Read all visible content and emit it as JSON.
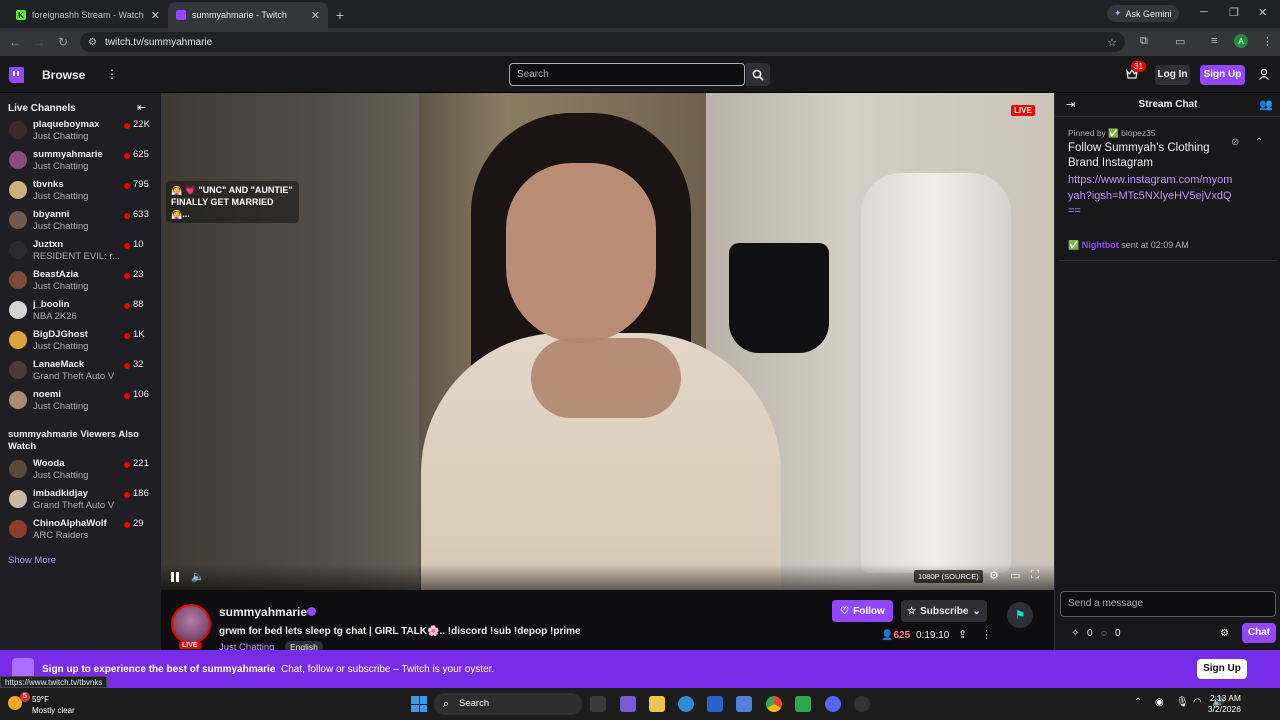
{
  "browser": {
    "tabs": [
      {
        "title": "foreignashh Stream - Watch Live",
        "favicon_color": "#53fc18",
        "favicon_letter": "K"
      },
      {
        "title": "summyahmarie - Twitch",
        "favicon_color": "#9147ff",
        "favicon_letter": ""
      }
    ],
    "gemini_label": "Ask Gemini",
    "url": "twitch.tv/summyahmarie",
    "profile_initial": "A"
  },
  "twitch_nav": {
    "browse": "Browse",
    "search_placeholder": "Search",
    "notifications_count": "31",
    "login": "Log In",
    "signup": "Sign Up"
  },
  "sidebar": {
    "live_header": "Live Channels",
    "channels": [
      {
        "name": "plaqueboymax",
        "game": "Just Chatting",
        "viewers": "22K",
        "avatar_color": "#3b2a2a"
      },
      {
        "name": "summyahmarie",
        "game": "Just Chatting",
        "viewers": "625",
        "avatar_color": "#8a4c78"
      },
      {
        "name": "tbvnks",
        "game": "Just Chatting",
        "viewers": "795",
        "avatar_color": "#c9b27e"
      },
      {
        "name": "bbyanni",
        "game": "Just Chatting",
        "viewers": "633",
        "avatar_color": "#6e5a4f"
      },
      {
        "name": "Juztxn",
        "game": "RESIDENT EVIL: r...",
        "viewers": "10",
        "avatar_color": "#2a2a2e"
      },
      {
        "name": "BeastAzia",
        "game": "Just Chatting",
        "viewers": "23",
        "avatar_color": "#7a4a3a"
      },
      {
        "name": "j_boolin",
        "game": "NBA 2K26",
        "viewers": "88",
        "avatar_color": "#d5d5d5"
      },
      {
        "name": "BigDJGhost",
        "game": "Just Chatting",
        "viewers": "1K",
        "avatar_color": "#d9a441"
      },
      {
        "name": "LanaeMack",
        "game": "Grand Theft Auto V",
        "viewers": "32",
        "avatar_color": "#4a3b36"
      },
      {
        "name": "noemi",
        "game": "Just Chatting",
        "viewers": "106",
        "avatar_color": "#a58d78"
      }
    ],
    "also_watch_header": "summyahmarie Viewers Also Watch",
    "also_watch": [
      {
        "name": "Wooda",
        "game": "Just Chatting",
        "viewers": "221",
        "avatar_color": "#5a4a3a"
      },
      {
        "name": "imbadkidjay",
        "game": "Grand Theft Auto V",
        "viewers": "186",
        "avatar_color": "#c7b9a5"
      },
      {
        "name": "ChinoAlphaWolf",
        "game": "ARC Raiders",
        "viewers": "29",
        "avatar_color": "#8c3b2f"
      }
    ],
    "show_more": "Show More"
  },
  "player": {
    "overlay_text": "👰 💗 \"UNC\" AND \"AUNTIE\" FINALLY GET MARRIED 👰...",
    "live_badge": "LIVE",
    "quality": "1080P (SOURCE)"
  },
  "stream_info": {
    "live_badge": "LIVE",
    "streamer": "summyahmarie",
    "title": "grwm for bed lets sleep tg chat | GIRL TALK🌸.. !discord !sub !depop !prime",
    "category": "Just Chatting",
    "tag": "English",
    "follow": "Follow",
    "subscribe": "Subscribe",
    "viewers": "625",
    "uptime": "0:19:10"
  },
  "chat": {
    "header": "Stream Chat",
    "pinned_by": "Pinned by ✅ blopez35",
    "pinned_message": "Follow Summyah's Clothing Brand Instagram",
    "pinned_link": "https://www.instagram.com/myomyah?igsh=MTc5NXlyeHV5ejVxdQ==",
    "sender": "Nightbot",
    "sent_at": "sent at 02:09 AM",
    "input_placeholder": "Send a message",
    "points_a": "0",
    "points_b": "0",
    "chat_button": "Chat"
  },
  "banner": {
    "lead": "Sign up to experience the best of summyahmarie",
    "rest": "Chat, follow or subscribe – Twitch is your oyster.",
    "signup": "Sign Up",
    "status_url": "https://www.twitch.tv/tbvnks"
  },
  "taskbar": {
    "temp": "59°F",
    "weather": "Mostly clear",
    "weather_badge": "5",
    "search": "Search",
    "time": "2:13 AM",
    "date": "3/2/2026"
  }
}
